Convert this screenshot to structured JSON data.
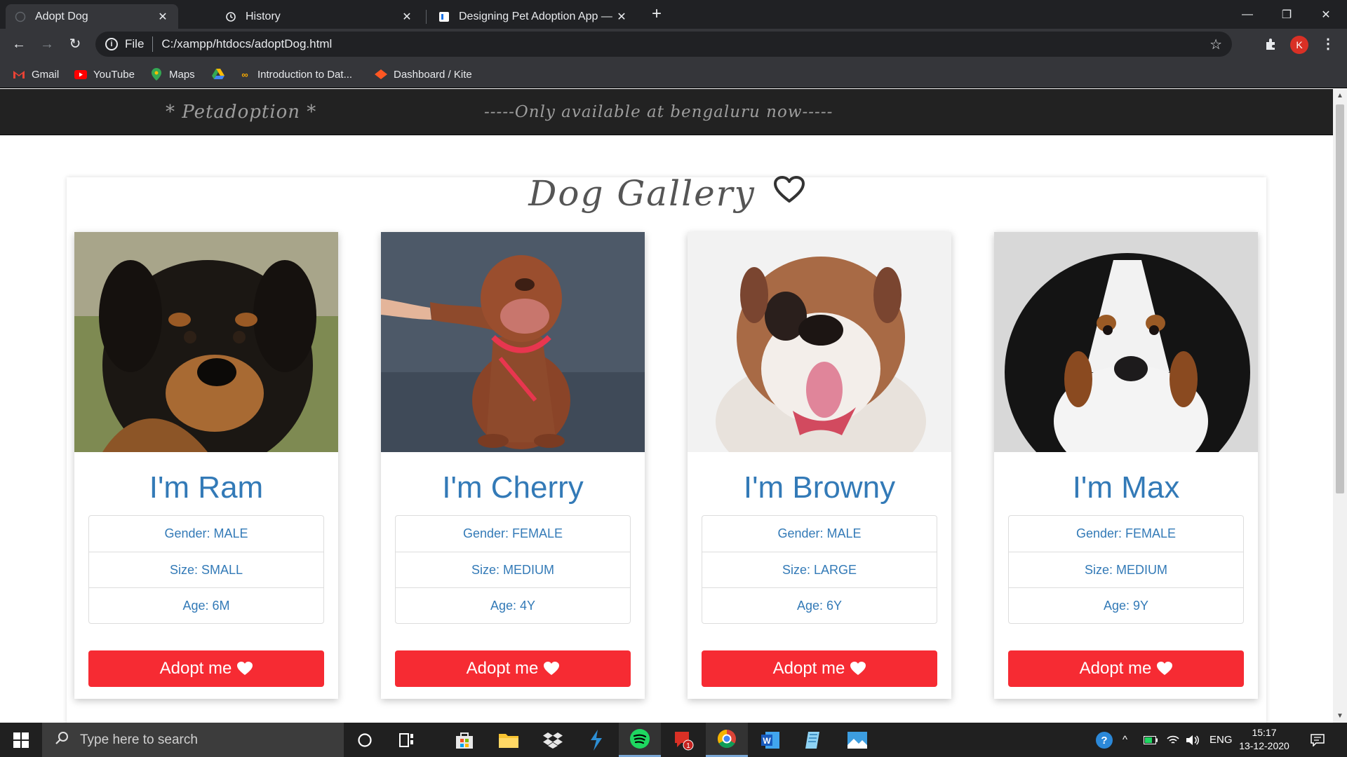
{
  "browser": {
    "tabs": [
      {
        "title": "Adopt Dog",
        "active": true,
        "icon": "globe-icon"
      },
      {
        "title": "History",
        "active": false,
        "icon": "history-icon"
      },
      {
        "title": "Designing Pet Adoption App — (",
        "active": false,
        "icon": "page-icon"
      }
    ],
    "address": {
      "scheme_label": "File",
      "url": "C:/xampp/htdocs/adoptDog.html"
    },
    "profile_initial": "K",
    "bookmarks": [
      {
        "label": "Gmail",
        "icon": "gmail-icon"
      },
      {
        "label": "YouTube",
        "icon": "youtube-icon"
      },
      {
        "label": "Maps",
        "icon": "maps-icon"
      },
      {
        "label": "",
        "icon": "drive-icon"
      },
      {
        "label": "Introduction to Dat...",
        "icon": "colab-icon"
      },
      {
        "label": "Dashboard / Kite",
        "icon": "kite-icon"
      }
    ]
  },
  "site": {
    "brand": "* Petadoption *",
    "notice": "-----Only available at bengaluru now-----",
    "gallery_title": "Dog Gallery",
    "adopt_label": "Adopt me",
    "dogs": [
      {
        "name": "I'm Ram",
        "gender": "Gender: MALE",
        "size": "Size: SMALL",
        "age": "Age: 6M",
        "photo": "rottweiler-puppy"
      },
      {
        "name": "I'm Cherry",
        "gender": "Gender: FEMALE",
        "size": "Size: MEDIUM",
        "age": "Age: 4Y",
        "photo": "pitbull-handshake"
      },
      {
        "name": "I'm Browny",
        "gender": "Gender: MALE",
        "size": "Size: LARGE",
        "age": "Age: 6Y",
        "photo": "bulldog"
      },
      {
        "name": "I'm Max",
        "gender": "Gender: FEMALE",
        "size": "Size: MEDIUM",
        "age": "Age: 9Y",
        "photo": "bernese-puppy"
      }
    ]
  },
  "colors": {
    "nav_bg": "#222222",
    "name_blue": "#337ab7",
    "adopt_red": "#f62b33"
  },
  "taskbar": {
    "search_placeholder": "Type here to search",
    "language": "ENG",
    "time": "15:17",
    "date": "13-12-2020",
    "apps": [
      "cortana-icon",
      "task-view-icon",
      "store-icon",
      "file-explorer-icon",
      "dropbox-icon",
      "vscode-icon",
      "spotify-icon",
      "messaging-icon",
      "chrome-icon",
      "word-icon",
      "notepad-icon",
      "photos-icon"
    ]
  }
}
